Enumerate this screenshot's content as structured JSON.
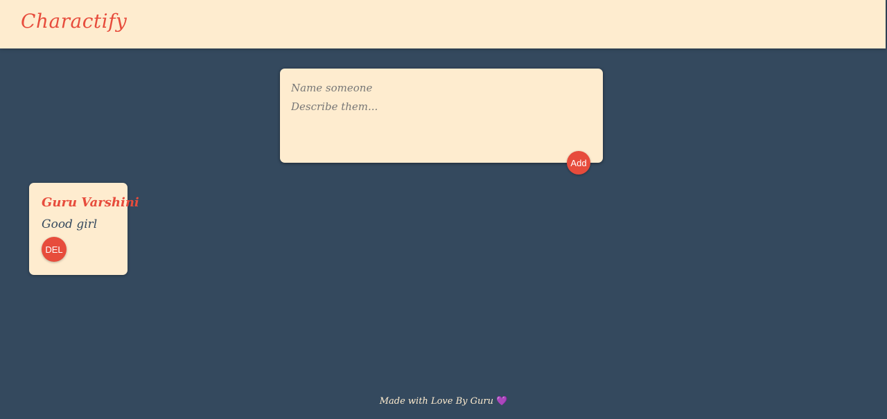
{
  "header": {
    "brand": "Charactify",
    "background_color": "#feeccf",
    "brand_color": "#e74c3c"
  },
  "compose": {
    "name_placeholder": "Name someone",
    "description_placeholder": "Describe them...",
    "add_label": "Add"
  },
  "notes": [
    {
      "title": "Guru Varshini",
      "description": "Good girl",
      "delete_label": "DEL"
    }
  ],
  "footer": {
    "text": "Made with Love By Guru",
    "icon": "purple-heart-icon",
    "icon_glyph": "💜"
  },
  "colors": {
    "page_background": "#34495e",
    "accent": "#e74c3c",
    "card_background": "#feeccf"
  }
}
